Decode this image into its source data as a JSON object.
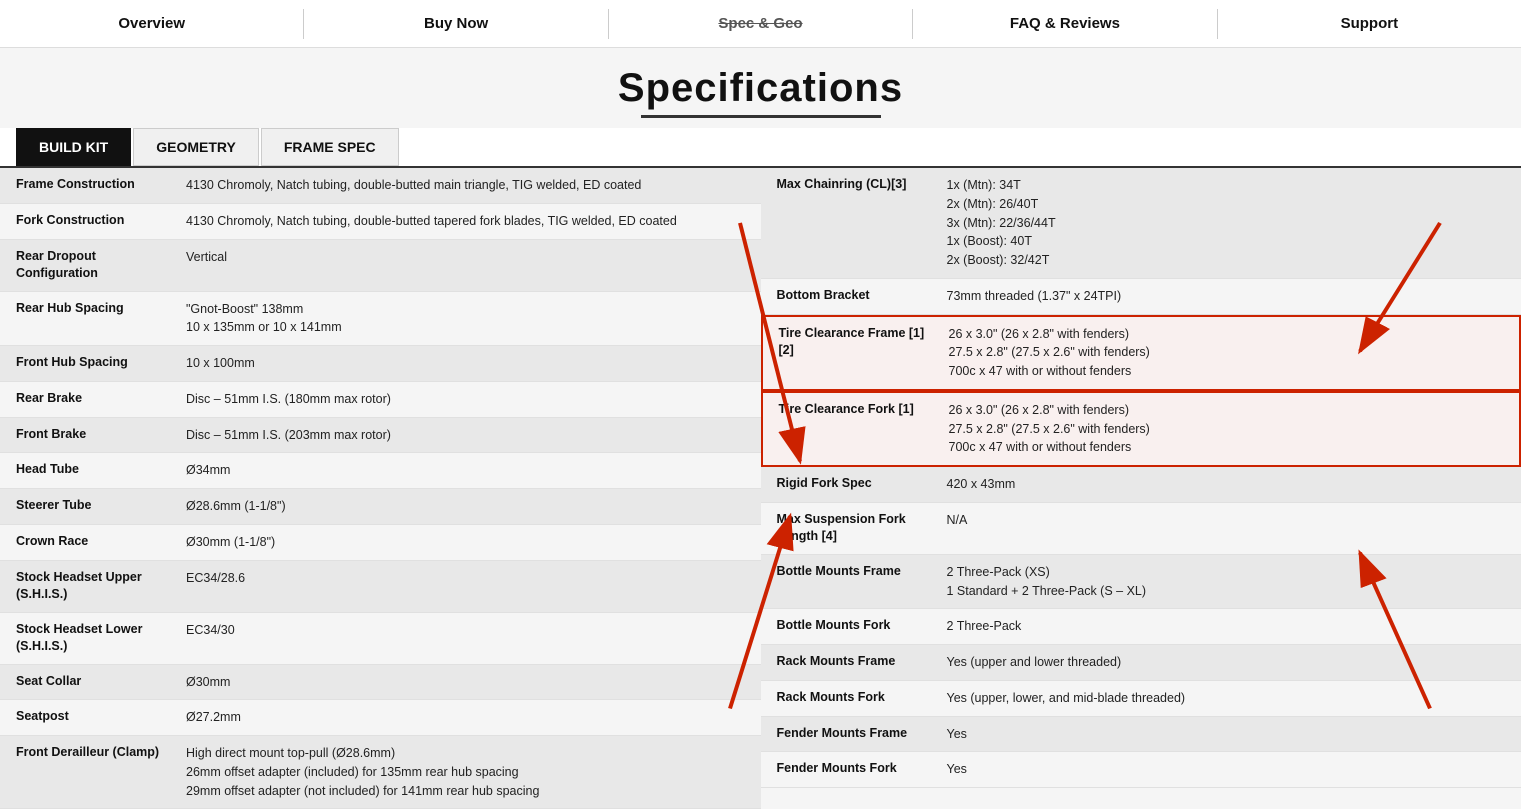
{
  "nav": {
    "items": [
      {
        "label": "Overview",
        "active": false
      },
      {
        "label": "Buy Now",
        "active": false
      },
      {
        "label": "Spec & Geo",
        "active": true
      },
      {
        "label": "FAQ & Reviews",
        "active": false
      },
      {
        "label": "Support",
        "active": false
      }
    ]
  },
  "pageTitle": "Specifications",
  "tabs": [
    {
      "label": "BUILD KIT",
      "active": true
    },
    {
      "label": "GEOMETRY",
      "active": false
    },
    {
      "label": "FRAME SPEC",
      "active": false
    }
  ],
  "leftSpecs": [
    {
      "label": "Frame Construction",
      "value": "4130 Chromoly, Natch tubing, double-butted main triangle, TIG welded, ED coated"
    },
    {
      "label": "Fork Construction",
      "value": "4130 Chromoly, Natch tubing, double-butted tapered fork blades, TIG welded, ED coated"
    },
    {
      "label": "Rear Dropout Configuration",
      "value": "Vertical"
    },
    {
      "label": "Rear Hub Spacing",
      "value": "\"Gnot-Boost\" 138mm\n10 x 135mm or 10 x 141mm"
    },
    {
      "label": "Front Hub Spacing",
      "value": "10 x 100mm"
    },
    {
      "label": "Rear Brake",
      "value": "Disc – 51mm I.S. (180mm max rotor)"
    },
    {
      "label": "Front Brake",
      "value": "Disc – 51mm I.S. (203mm max rotor)"
    },
    {
      "label": "Head Tube",
      "value": "Ø34mm"
    },
    {
      "label": "Steerer Tube",
      "value": "Ø28.6mm (1-1/8\")"
    },
    {
      "label": "Crown Race",
      "value": "Ø30mm (1-1/8\")"
    },
    {
      "label": "Stock Headset Upper (S.H.I.S.)",
      "value": "EC34/28.6"
    },
    {
      "label": "Stock Headset Lower (S.H.I.S.)",
      "value": "EC34/30"
    },
    {
      "label": "Seat Collar",
      "value": "Ø30mm"
    },
    {
      "label": "Seatpost",
      "value": "Ø27.2mm"
    },
    {
      "label": "Front Derailleur (Clamp)",
      "value": "High direct mount top-pull (Ø28.6mm)\n26mm offset adapter (included) for 135mm rear hub spacing\n29mm offset adapter (not included) for 141mm rear hub spacing"
    }
  ],
  "rightSpecs": [
    {
      "label": "Max Chainring (CL)[3]",
      "value": "1x (Mtn): 34T\n2x (Mtn): 26/40T\n3x (Mtn): 22/36/44T\n1x (Boost): 40T\n2x (Boost): 32/42T",
      "highlight": false
    },
    {
      "label": "Bottom Bracket",
      "value": "73mm threaded (1.37\" x 24TPI)",
      "highlight": false
    },
    {
      "label": "Tire Clearance Frame [1][2]",
      "value": "26 x 3.0\" (26 x 2.8\" with fenders)\n27.5 x 2.8\" (27.5 x 2.6\" with fenders)\n700c x 47 with or without fenders",
      "highlight": true
    },
    {
      "label": "Tire Clearance Fork [1]",
      "value": "26 x 3.0\" (26 x 2.8\" with fenders)\n27.5 x 2.8\" (27.5 x 2.6\" with fenders)\n700c x 47 with or without fenders",
      "highlight": true
    },
    {
      "label": "Rigid Fork Spec",
      "value": "420 x 43mm",
      "highlight": false
    },
    {
      "label": "Max Suspension Fork Length [4]",
      "value": "N/A",
      "highlight": false
    },
    {
      "label": "Bottle Mounts Frame",
      "value": "2 Three-Pack (XS)\n1 Standard + 2 Three-Pack (S – XL)",
      "highlight": false
    },
    {
      "label": "Bottle Mounts Fork",
      "value": "2 Three-Pack",
      "highlight": false
    },
    {
      "label": "Rack Mounts Frame",
      "value": "Yes (upper and lower threaded)",
      "highlight": false
    },
    {
      "label": "Rack Mounts Fork",
      "value": "Yes (upper, lower, and mid-blade threaded)",
      "highlight": false
    },
    {
      "label": "Fender Mounts Frame",
      "value": "Yes",
      "highlight": false
    },
    {
      "label": "Fender Mounts Fork",
      "value": "Yes",
      "highlight": false
    }
  ]
}
